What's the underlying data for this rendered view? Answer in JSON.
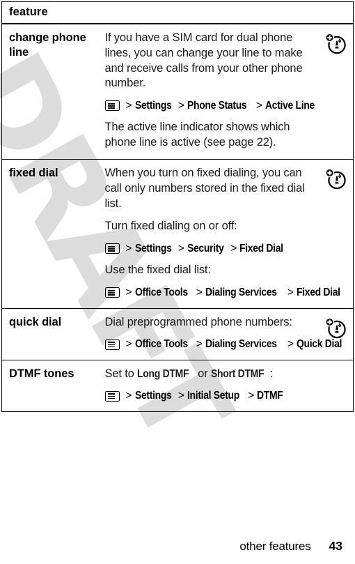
{
  "watermark": {
    "text": "DRAFT",
    "color": "#dcdcdc"
  },
  "table": {
    "header": {
      "label": "feature"
    },
    "rows": [
      {
        "feature": "change phone line",
        "icon": "network-service-icon",
        "blocks": [
          {
            "type": "paragraph",
            "text": "If you have a SIM card for dual phone lines, you can change your line to make and receive calls from your other phone number."
          },
          {
            "type": "path",
            "icon": "menu-icon",
            "segments": [
              "Settings",
              "Phone Status",
              "Active Line"
            ],
            "separator": ">"
          },
          {
            "type": "paragraph",
            "text": "The active line indicator shows which phone line is active (see page 22)."
          }
        ]
      },
      {
        "feature": "fixed dial",
        "icon": "network-service-icon",
        "blocks": [
          {
            "type": "paragraph",
            "text": "When you turn on fixed dialing, you can call only numbers stored in the fixed dial list."
          },
          {
            "type": "paragraph",
            "text": "Turn fixed dialing on or off:"
          },
          {
            "type": "path",
            "icon": "menu-icon",
            "segments": [
              "Settings",
              "Security",
              "Fixed Dial"
            ],
            "separator": ">"
          },
          {
            "type": "paragraph",
            "text": "Use the fixed dial list:"
          },
          {
            "type": "path",
            "icon": "menu-icon",
            "segments": [
              "Office Tools",
              "Dialing Services",
              "Fixed Dial"
            ],
            "separator": ">"
          }
        ]
      },
      {
        "feature": "quick dial",
        "icon": "network-service-icon",
        "blocks": [
          {
            "type": "paragraph",
            "text": "Dial preprogrammed phone numbers:"
          },
          {
            "type": "path",
            "icon": "menu-icon",
            "segments": [
              "Office Tools",
              "Dialing Services",
              "Quick Dial"
            ],
            "separator": ">"
          }
        ]
      },
      {
        "feature": "DTMF tones",
        "icon": null,
        "blocks": [
          {
            "type": "mixed",
            "prefix": "Set to ",
            "option_a": "Long DTMF",
            "middle": " or ",
            "option_b": "Short DTMF",
            "suffix": ":"
          },
          {
            "type": "path",
            "icon": "menu-icon",
            "segments": [
              "Settings",
              "Initial Setup",
              "DTMF"
            ],
            "separator": ">"
          }
        ]
      }
    ]
  },
  "footer": {
    "title": "other features",
    "page": "43"
  }
}
